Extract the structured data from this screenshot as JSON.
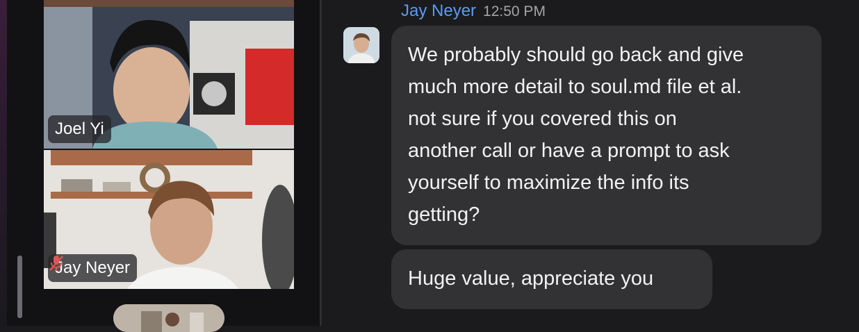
{
  "participants": [
    {
      "name": "Joel Yi",
      "muted": false
    },
    {
      "name": "Jay Neyer",
      "muted": true
    }
  ],
  "chat": {
    "sender": "Jay Neyer",
    "time": "12:50 PM",
    "messages": [
      [
        "We probably should go back and give",
        "much more detail to soul.md file et al.",
        "not sure if you covered this on",
        "another call or have a prompt to ask",
        "yourself to maximize the info its",
        "getting?"
      ],
      [
        "Huge value, appreciate you"
      ]
    ]
  },
  "colors": {
    "sender": "#5b9bf0",
    "bubble": "#323235",
    "mute_icon": "#e05555"
  },
  "icons": {
    "mute": "microphone-off-icon"
  }
}
